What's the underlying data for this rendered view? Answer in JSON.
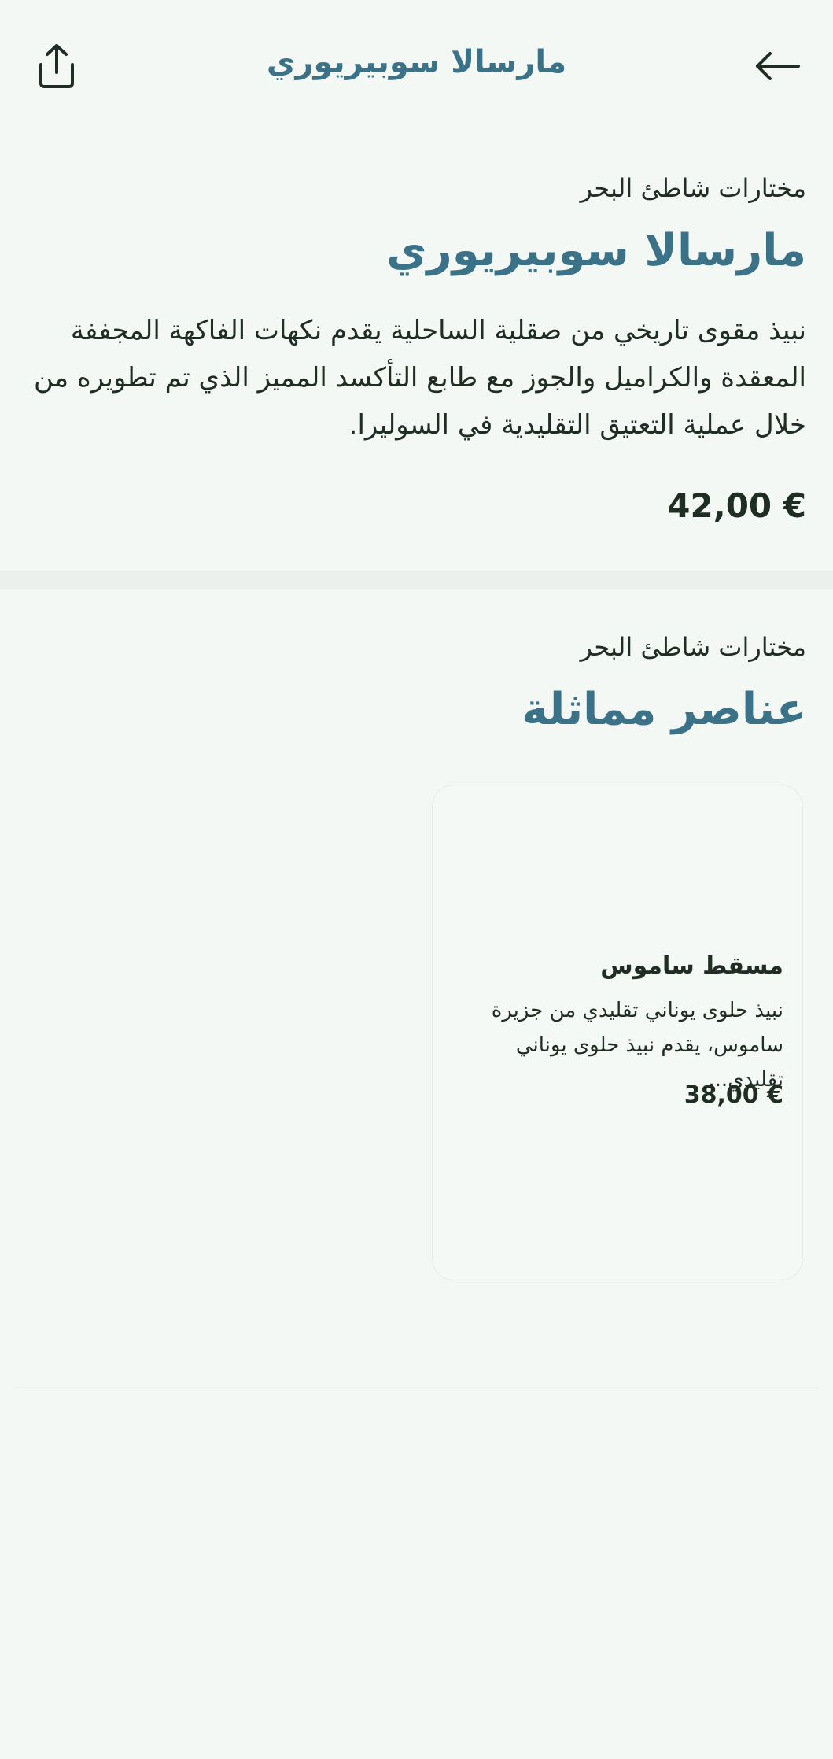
{
  "header": {
    "title": "مارسالا سوبيريوري",
    "share_icon": "share-icon",
    "back_icon": "arrow-left-icon"
  },
  "product": {
    "category": "مختارات شاطئ البحر",
    "name": "مارسالا سوبيريوري",
    "description": "نبيذ مقوى تاريخي من صقلية الساحلية يقدم نكهات الفاكهة المجففة المعقدة والكراميل والجوز مع طابع التأكسد المميز الذي تم تطويره من خلال عملية التعتيق التقليدية في السوليرا.",
    "price": "42,00 €"
  },
  "similar": {
    "category": "مختارات شاطئ البحر",
    "title": "عناصر مماثلة",
    "items": [
      {
        "name": "مسقط ساموس",
        "description": "نبيذ حلوى يوناني تقليدي من جزيرة ساموس، يقدم نبيذ حلوى يوناني تقليدي...",
        "price": "38,00 €"
      }
    ]
  },
  "colors": {
    "background": "#f4f8f4",
    "accent": "#3b7287",
    "text": "#1f2d24",
    "divider": "#ebf0ec"
  }
}
